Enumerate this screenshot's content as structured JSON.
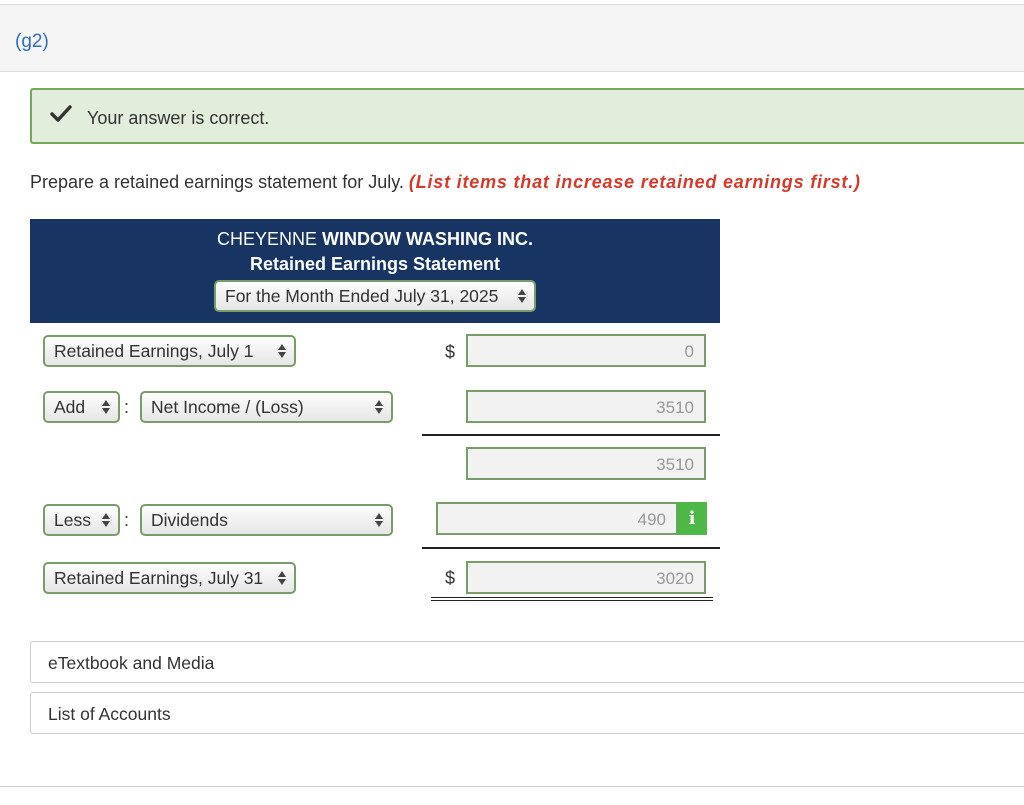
{
  "part_label": "(g2)",
  "feedback": {
    "text": "Your answer is correct.",
    "icon": "checkmark-icon",
    "color": "#74a95c"
  },
  "instruction": {
    "text": "Prepare a retained earnings statement for July.",
    "highlight": "(List items that increase retained earnings first.)"
  },
  "statement": {
    "company_prefix": "CHEYENNE ",
    "company_bold": "WINDOW WASHING INC.",
    "title": "Retained Earnings Statement",
    "period": "For the Month Ended July 31, 2025",
    "header_color": "#183462"
  },
  "rows": {
    "beginning": {
      "label": "Retained Earnings, July 1",
      "currency": "$",
      "value": "0"
    },
    "add": {
      "operator": "Add",
      "label": "Net Income / (Loss)",
      "value": "3510"
    },
    "subtotal": {
      "value": "3510"
    },
    "less": {
      "operator": "Less",
      "label": "Dividends",
      "value": "490",
      "info_label": "i"
    },
    "ending": {
      "label": "Retained Earnings, July 31",
      "currency": "$",
      "value": "3020"
    }
  },
  "links": {
    "etextbook": "eTextbook and Media",
    "accounts": "List of Accounts"
  }
}
